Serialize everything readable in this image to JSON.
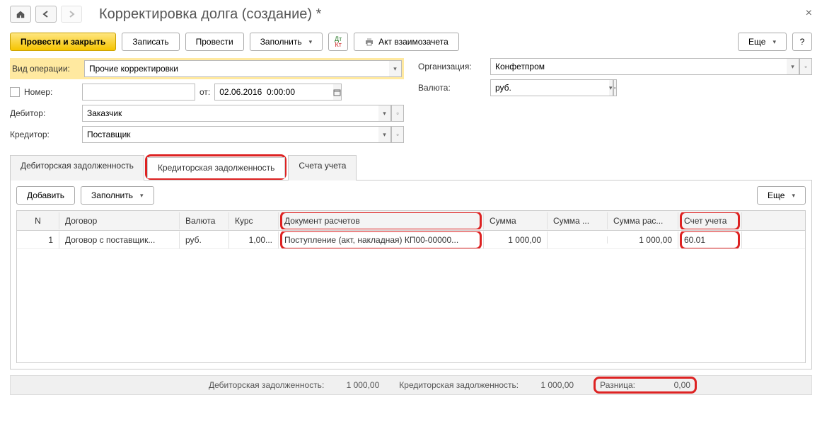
{
  "title": "Корректировка долга (создание) *",
  "toolbar": {
    "post_close": "Провести и закрыть",
    "save": "Записать",
    "post": "Провести",
    "fill": "Заполнить",
    "offset_act": "Акт взаимозачета",
    "more": "Еще"
  },
  "form": {
    "operation_label": "Вид операции:",
    "operation_value": "Прочие корректировки",
    "number_label": "Номер:",
    "number_value": "",
    "date_label": "от:",
    "date_value": "02.06.2016  0:00:00",
    "org_label": "Организация:",
    "org_value": "Конфетпром",
    "currency_label": "Валюта:",
    "currency_value": "руб.",
    "debtor_label": "Дебитор:",
    "debtor_value": "Заказчик",
    "creditor_label": "Кредитор:",
    "creditor_value": "Поставщик"
  },
  "tabs": {
    "debit": "Дебиторская задолженность",
    "credit": "Кредиторская задолженность",
    "accounts": "Счета учета"
  },
  "tab_toolbar": {
    "add": "Добавить",
    "fill": "Заполнить",
    "more": "Еще"
  },
  "table": {
    "headers": {
      "n": "N",
      "contract": "Договор",
      "currency": "Валюта",
      "rate": "Курс",
      "doc": "Документ расчетов",
      "sum": "Сумма",
      "sum2": "Сумма ...",
      "sum3": "Сумма рас...",
      "account": "Счет учета"
    },
    "rows": [
      {
        "n": "1",
        "contract": "Договор с поставщик...",
        "currency": "руб.",
        "rate": "1,00...",
        "doc": "Поступление (акт, накладная) КП00-00000...",
        "sum": "1 000,00",
        "sum2": "",
        "sum3": "1 000,00",
        "account": "60.01"
      }
    ]
  },
  "footer": {
    "debit_label": "Дебиторская задолженность:",
    "debit_value": "1 000,00",
    "credit_label": "Кредиторская задолженность:",
    "credit_value": "1 000,00",
    "diff_label": "Разница:",
    "diff_value": "0,00"
  }
}
